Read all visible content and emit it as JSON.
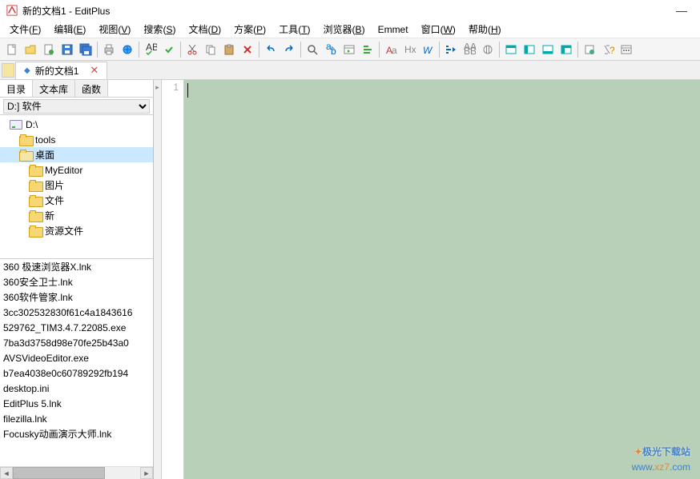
{
  "title": "新的文档1 - EditPlus",
  "minimize": "—",
  "menu": {
    "file": {
      "label": "文件",
      "u": "F"
    },
    "edit": {
      "label": "编辑",
      "u": "E"
    },
    "view": {
      "label": "视图",
      "u": "V"
    },
    "search": {
      "label": "搜索",
      "u": "S"
    },
    "document": {
      "label": "文档",
      "u": "D"
    },
    "project": {
      "label": "方案",
      "u": "P"
    },
    "tools": {
      "label": "工具",
      "u": "T"
    },
    "browser": {
      "label": "浏览器",
      "u": "B"
    },
    "emmet": {
      "label": "Emmet"
    },
    "window": {
      "label": "窗口",
      "u": "W"
    },
    "help": {
      "label": "帮助",
      "u": "H"
    }
  },
  "doctab": {
    "name": "新的文档1"
  },
  "sidebar": {
    "tabs": {
      "dir": "目录",
      "textlib": "文本库",
      "func": "函数"
    },
    "drive": "D:] 软件",
    "tree": [
      {
        "label": "D:\\",
        "indent": 12,
        "icon": "drive"
      },
      {
        "label": "tools",
        "indent": 24,
        "icon": "folder"
      },
      {
        "label": "桌面",
        "indent": 24,
        "icon": "folder-open",
        "selected": true
      },
      {
        "label": "MyEditor",
        "indent": 36,
        "icon": "folder"
      },
      {
        "label": "图片",
        "indent": 36,
        "icon": "folder"
      },
      {
        "label": "文件",
        "indent": 36,
        "icon": "folder"
      },
      {
        "label": "新",
        "indent": 36,
        "icon": "folder"
      },
      {
        "label": "资源文件",
        "indent": 36,
        "icon": "folder"
      }
    ],
    "files": [
      "360 极速浏览器X.lnk",
      "360安全卫士.lnk",
      "360软件管家.lnk",
      "3cc302532830f61c4a1843616",
      "529762_TIM3.4.7.22085.exe",
      "7ba3d3758d98e70fe25b43a0",
      "AVSVideoEditor.exe",
      "b7ea4038e0c60789292fb194",
      "desktop.ini",
      "EditPlus 5.lnk",
      "filezilla.lnk",
      "Focusky动画演示大师.lnk"
    ]
  },
  "gutter": {
    "line1": "1"
  },
  "watermark": {
    "line1": "极光下载站",
    "line2a": "www.",
    "line2b": "xz7",
    "line2c": ".com"
  }
}
